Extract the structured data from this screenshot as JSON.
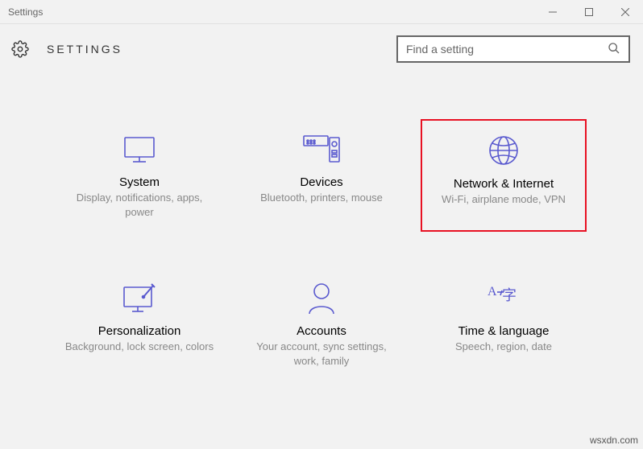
{
  "window": {
    "title": "Settings"
  },
  "header": {
    "title": "SETTINGS"
  },
  "search": {
    "placeholder": "Find a setting"
  },
  "tiles": {
    "system": {
      "title": "System",
      "desc": "Display, notifications, apps, power"
    },
    "devices": {
      "title": "Devices",
      "desc": "Bluetooth, printers, mouse"
    },
    "network": {
      "title": "Network & Internet",
      "desc": "Wi-Fi, airplane mode, VPN"
    },
    "personalization": {
      "title": "Personalization",
      "desc": "Background, lock screen, colors"
    },
    "accounts": {
      "title": "Accounts",
      "desc": "Your account, sync settings, work, family"
    },
    "timelang": {
      "title": "Time & language",
      "desc": "Speech, region, date"
    }
  },
  "watermark": "wsxdn.com",
  "colors": {
    "accent": "#5a5acf",
    "highlight": "#e81123"
  }
}
